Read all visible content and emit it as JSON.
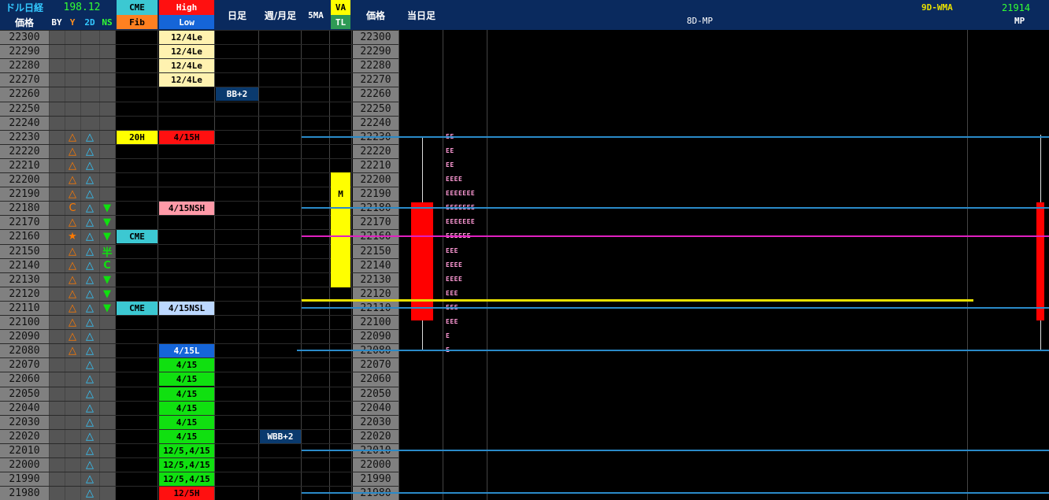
{
  "header": {
    "pair_label": "ドル日経",
    "pair_value": "198.12",
    "price_label": "価格",
    "sub_labels": [
      "BY",
      "Y",
      "2D",
      "NS"
    ],
    "cme": "CME",
    "fib": "Fib",
    "high": "High",
    "low": "Low",
    "daily": "日足",
    "weekly_monthly": "週/月足",
    "ma5": "5MA",
    "va": "VA",
    "tl": "TL",
    "price2_label": "価格",
    "today_label": "当日足",
    "mp8d": "8D-MP",
    "wma9d_label": "9D-WMA",
    "wma9d_value": "21914",
    "mp_label": "MP"
  },
  "prices": [
    "22300",
    "22290",
    "22280",
    "22270",
    "22260",
    "22250",
    "22240",
    "22230",
    "22220",
    "22210",
    "22200",
    "22190",
    "22180",
    "22170",
    "22160",
    "22150",
    "22140",
    "22130",
    "22120",
    "22110",
    "22100",
    "22090",
    "22080",
    "22070",
    "22060",
    "22050",
    "22040",
    "22030",
    "22020",
    "22010",
    "22000",
    "21990",
    "21980"
  ],
  "marks_y": [
    {
      "row": 7,
      "t": "△"
    },
    {
      "row": 8,
      "t": "△"
    },
    {
      "row": 9,
      "t": "△"
    },
    {
      "row": 10,
      "t": "△"
    },
    {
      "row": 11,
      "t": "△"
    },
    {
      "row": 12,
      "t": "C"
    },
    {
      "row": 13,
      "t": "△"
    },
    {
      "row": 14,
      "t": "★"
    },
    {
      "row": 15,
      "t": "△"
    },
    {
      "row": 16,
      "t": "△"
    },
    {
      "row": 17,
      "t": "△"
    },
    {
      "row": 18,
      "t": "△"
    },
    {
      "row": 19,
      "t": "△"
    },
    {
      "row": 20,
      "t": "△"
    },
    {
      "row": 21,
      "t": "△"
    },
    {
      "row": 22,
      "t": "△"
    }
  ],
  "marks_2d": [
    7,
    8,
    9,
    10,
    11,
    12,
    13,
    14,
    15,
    16,
    17,
    18,
    19,
    20,
    21,
    22,
    23,
    24,
    25,
    26,
    27,
    28,
    29,
    30,
    31,
    32
  ],
  "marks_ns": [
    {
      "row": 12,
      "t": "▼"
    },
    {
      "row": 13,
      "t": "▼"
    },
    {
      "row": 14,
      "t": "▼"
    },
    {
      "row": 15,
      "t": "半"
    },
    {
      "row": 16,
      "t": "C"
    },
    {
      "row": 17,
      "t": "▼"
    },
    {
      "row": 18,
      "t": "▼"
    },
    {
      "row": 19,
      "t": "▼"
    }
  ],
  "cme_fib": [
    {
      "row": 7,
      "t": "20H",
      "bg": "#ffff00",
      "fg": "#000"
    },
    {
      "row": 14,
      "t": "CME",
      "bg": "#3cc8d2",
      "fg": "#000"
    },
    {
      "row": 19,
      "t": "CME",
      "bg": "#3cc8d2",
      "fg": "#000"
    }
  ],
  "high_low": [
    {
      "row": 0,
      "t": "12/4Le",
      "bg": "#fff2b0",
      "fg": "#000"
    },
    {
      "row": 1,
      "t": "12/4Le",
      "bg": "#fff2b0",
      "fg": "#000"
    },
    {
      "row": 2,
      "t": "12/4Le",
      "bg": "#fff2b0",
      "fg": "#000"
    },
    {
      "row": 3,
      "t": "12/4Le",
      "bg": "#fff2b0",
      "fg": "#000"
    },
    {
      "row": 7,
      "t": "4/15H",
      "bg": "#ff1010",
      "fg": "#000"
    },
    {
      "row": 12,
      "t": "4/15NSH",
      "bg": "#ff9aa8",
      "fg": "#000"
    },
    {
      "row": 19,
      "t": "4/15NSL",
      "bg": "#bcd8ff",
      "fg": "#000"
    },
    {
      "row": 22,
      "t": "4/15L",
      "bg": "#1565d8",
      "fg": "#fff"
    },
    {
      "row": 23,
      "t": "4/15",
      "bg": "#10e010",
      "fg": "#000"
    },
    {
      "row": 24,
      "t": "4/15",
      "bg": "#10e010",
      "fg": "#000"
    },
    {
      "row": 25,
      "t": "4/15",
      "bg": "#10e010",
      "fg": "#000"
    },
    {
      "row": 26,
      "t": "4/15",
      "bg": "#10e010",
      "fg": "#000"
    },
    {
      "row": 27,
      "t": "4/15",
      "bg": "#10e010",
      "fg": "#000"
    },
    {
      "row": 28,
      "t": "4/15",
      "bg": "#10e010",
      "fg": "#000"
    },
    {
      "row": 29,
      "t": "12/5,4/15",
      "bg": "#10e010",
      "fg": "#000"
    },
    {
      "row": 30,
      "t": "12/5,4/15",
      "bg": "#10e010",
      "fg": "#000"
    },
    {
      "row": 31,
      "t": "12/5,4/15",
      "bg": "#10e010",
      "fg": "#000"
    },
    {
      "row": 32,
      "t": "12/5H",
      "bg": "#ff1010",
      "fg": "#000"
    }
  ],
  "daily": [
    {
      "row": 4,
      "t": "BB+2",
      "bg": "#0a3a6e",
      "fg": "#fff"
    }
  ],
  "weekly": [
    {
      "row": 28,
      "t": "WBB+2",
      "bg": "#0a3a6e",
      "fg": "#fff"
    }
  ],
  "va": [
    {
      "row": 11,
      "t": "M"
    }
  ],
  "va_rows": [
    10,
    11,
    12,
    13,
    14,
    15,
    16,
    17
  ],
  "tpo": [
    {
      "row": 7,
      "t": "EE"
    },
    {
      "row": 8,
      "t": "EE"
    },
    {
      "row": 9,
      "t": "EE"
    },
    {
      "row": 10,
      "t": "EEEE"
    },
    {
      "row": 11,
      "t": "EEEEEEE"
    },
    {
      "row": 12,
      "t": "EEEEEEE"
    },
    {
      "row": 13,
      "t": "EEEEEEE"
    },
    {
      "row": 14,
      "t": "EEEEEE"
    },
    {
      "row": 15,
      "t": "EEE"
    },
    {
      "row": 16,
      "t": "EEEE"
    },
    {
      "row": 17,
      "t": "EEEE"
    },
    {
      "row": 18,
      "t": "EEE"
    },
    {
      "row": 19,
      "t": "EEE"
    },
    {
      "row": 20,
      "t": "EEE"
    },
    {
      "row": 21,
      "t": "E"
    },
    {
      "row": 22,
      "t": "E"
    }
  ],
  "colors": {
    "header_bg": "#0a2a5e",
    "price_bg": "#808080",
    "green_value": "#33ff33",
    "magenta_line": "#e020c0",
    "blue_line": "#2a8ac8",
    "yellow_line": "#e8e000",
    "candle_red": "#ff0000"
  }
}
